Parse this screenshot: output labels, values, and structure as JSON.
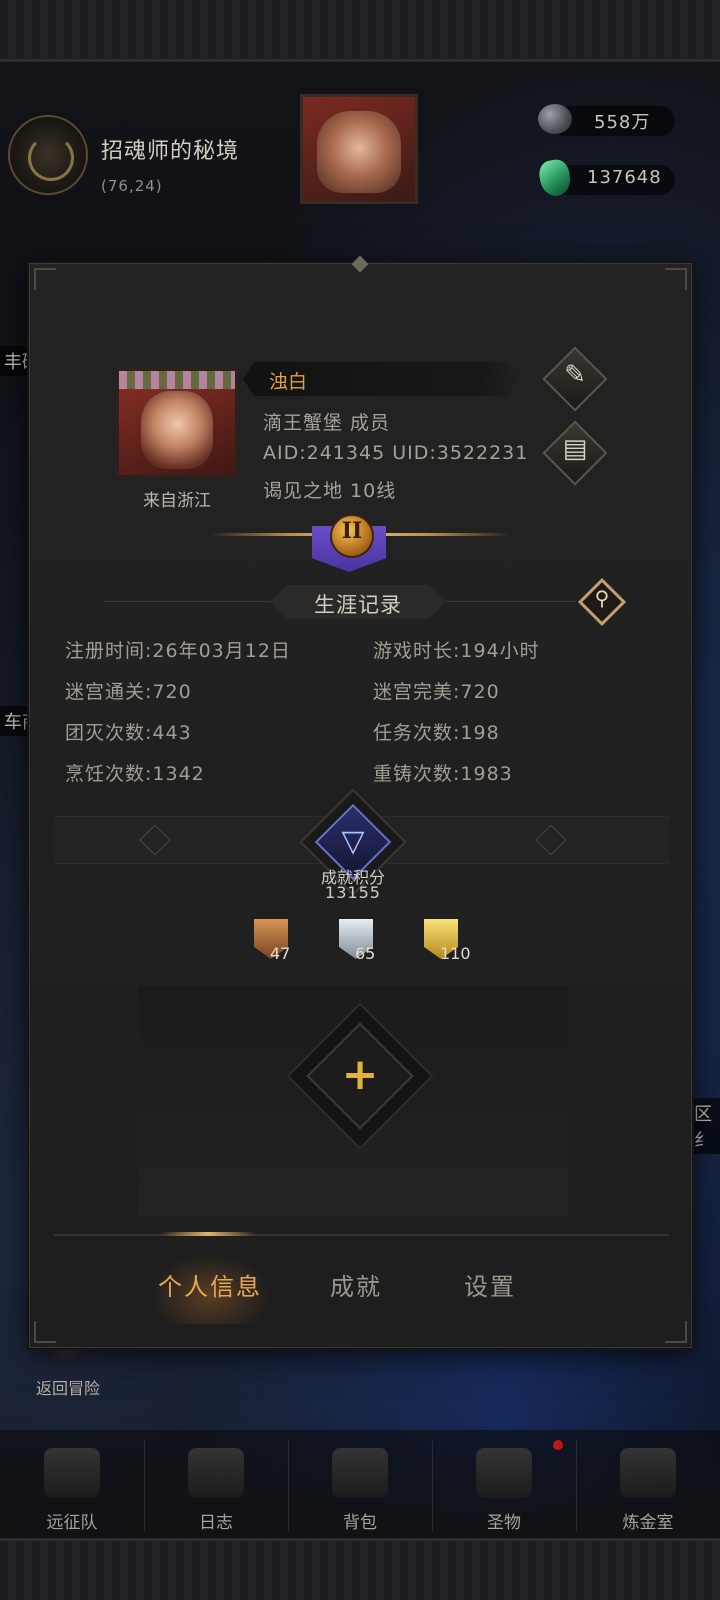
{
  "location": {
    "name": "招魂师的秘境",
    "coords": "(76,24)"
  },
  "currency": {
    "silver": "558万",
    "gems": "137648"
  },
  "side_labels": {
    "left1": "丰碛",
    "left2": "车商",
    "right1": "区纟"
  },
  "profile": {
    "name": "浊白",
    "guild": "滴王蟹堡  成员",
    "ids": "AID:241345 UID:3522231",
    "server": "谒见之地  10线",
    "origin": "来自浙江",
    "rank_numeral": "II"
  },
  "career": {
    "title": "生涯记录",
    "stats": [
      {
        "label": "注册时间:",
        "value": "26年03月12日"
      },
      {
        "label": "游戏时长:",
        "value": "194小时"
      },
      {
        "label": "迷宫通关:",
        "value": "720"
      },
      {
        "label": "迷宫完美:",
        "value": "720"
      },
      {
        "label": "团灭次数:",
        "value": "443"
      },
      {
        "label": "任务次数:",
        "value": "198"
      },
      {
        "label": "烹饪次数:",
        "value": "1342"
      },
      {
        "label": "重铸次数:",
        "value": "1983"
      }
    ]
  },
  "achievement": {
    "label": "成就积分",
    "score": "13155",
    "badges": [
      {
        "tier": "bronze",
        "count": "47"
      },
      {
        "tier": "silver",
        "count": "65"
      },
      {
        "tier": "gold",
        "count": "110"
      }
    ]
  },
  "tabs": [
    {
      "label": "个人信息",
      "active": true
    },
    {
      "label": "成就",
      "active": false
    },
    {
      "label": "设置",
      "active": false
    }
  ],
  "return_label": "返回冒险",
  "bottom_nav": [
    "远征队",
    "日志",
    "背包",
    "圣物",
    "炼金室"
  ],
  "icons": {
    "edit": "feather-icon",
    "record": "scroll-icon",
    "search": "magnifier-icon",
    "add": "plus-icon"
  },
  "colors": {
    "accent": "#e5a955",
    "name": "#e0a042",
    "panel": "#222222"
  }
}
